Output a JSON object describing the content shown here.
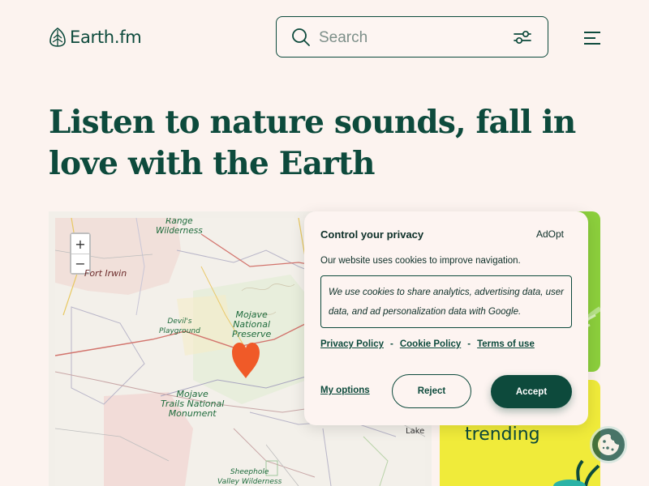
{
  "header": {
    "logo_text": "Earth.fm",
    "search_placeholder": "Search",
    "icons": [
      "leaf-logo-icon",
      "search-icon",
      "filter-sliders-icon",
      "hamburger-menu-icon"
    ]
  },
  "hero": {
    "headline": "Listen to nature sounds, fall in love with the Earth"
  },
  "map": {
    "zoom_in": "+",
    "zoom_out": "−",
    "labels": {
      "range_wilderness": "Range\nWilderness",
      "fort_irwin": "Fort Irwin",
      "devils_playground": "Devil's\nPlayground",
      "mojave_preserve": "Mojave\nNational\nPreserve",
      "mojave_trails": "Mojave\nTrails National\nMonument",
      "lake": "Lake",
      "sheephole": "Sheephole\nValley Wilderness"
    },
    "marker_color": "#f05a28"
  },
  "cards": {
    "trending_label": "trending",
    "green": "#8ccf3c",
    "yellow": "#f0eb3a"
  },
  "cookie": {
    "title": "Control your privacy",
    "brand": "AdOpt",
    "intro": "Our website uses cookies to improve navigation.",
    "detail": "We use cookies to share analytics, advertising data, user data, and ad personalization data with Google.",
    "links": {
      "privacy": "Privacy Policy",
      "cookie": "Cookie Policy",
      "terms": "Terms of use",
      "separator": "-"
    },
    "my_options": "My options",
    "reject": "Reject",
    "accept": "Accept"
  },
  "colors": {
    "brand_dark_green": "#0d4a3c",
    "background": "#fcf3ef"
  }
}
